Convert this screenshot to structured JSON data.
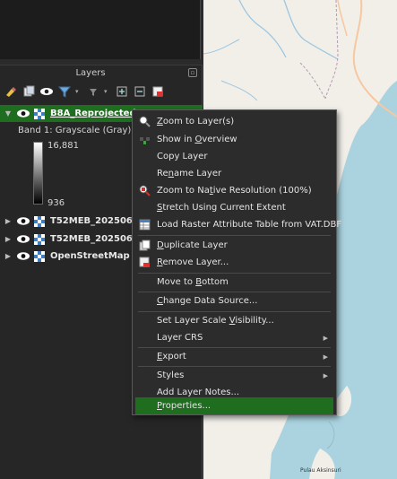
{
  "layers_panel": {
    "title": "Layers",
    "toolbar_icons": [
      "open-layer-styling-icon",
      "add-group-icon",
      "manage-visibility-icon",
      "filter-legend-icon",
      "filter-by-expression-icon",
      "expand-all-icon",
      "collapse-all-icon",
      "remove-layer-icon"
    ]
  },
  "layers": [
    {
      "name": "B8A_Reprojected",
      "selected": true,
      "expanded": true
    },
    {
      "name": "T52MEB_20250610T",
      "selected": false,
      "expanded": false
    },
    {
      "name": "T52MEB_20250610T",
      "selected": false,
      "expanded": false
    },
    {
      "name": "OpenStreetMap",
      "selected": false,
      "expanded": false
    }
  ],
  "legend": {
    "band_label": "Band 1: Grayscale (Gray)",
    "max": "16,881",
    "min": "936"
  },
  "context_menu": {
    "items": [
      {
        "pre": "",
        "mn": "Z",
        "post": "oom to Layer(s)",
        "icon": "zoom-to-layer-icon"
      },
      {
        "pre": "Show in ",
        "mn": "O",
        "post": "verview",
        "icon": "show-overview-icon"
      },
      {
        "pre": "Copy Layer",
        "mn": "",
        "post": "",
        "icon": ""
      },
      {
        "pre": "Re",
        "mn": "n",
        "post": "ame Layer",
        "icon": ""
      },
      {
        "pre": "Zoom to Na",
        "mn": "t",
        "post": "ive Resolution (100%)",
        "icon": "zoom-native-icon"
      },
      {
        "pre": "",
        "mn": "S",
        "post": "tretch Using Current Extent",
        "icon": ""
      },
      {
        "pre": "Load Raster Attribute Table from VAT.DBF",
        "mn": "",
        "post": "",
        "icon": "table-icon"
      },
      {
        "pre": "",
        "mn": "D",
        "post": "uplicate Layer",
        "icon": "duplicate-icon"
      },
      {
        "pre": "",
        "mn": "R",
        "post": "emove Layer...",
        "icon": "remove-icon"
      },
      {
        "pre": "Move to ",
        "mn": "B",
        "post": "ottom",
        "icon": ""
      },
      {
        "pre": "",
        "mn": "C",
        "post": "hange Data Source...",
        "icon": ""
      },
      {
        "pre": "Set Layer Scale ",
        "mn": "V",
        "post": "isibility...",
        "icon": ""
      },
      {
        "pre": "Layer CRS",
        "mn": "",
        "post": "",
        "icon": "",
        "submenu": true
      },
      {
        "pre": "",
        "mn": "E",
        "post": "xport",
        "icon": "",
        "submenu": true
      },
      {
        "pre": "Styles",
        "mn": "",
        "post": "",
        "icon": "",
        "submenu": true
      },
      {
        "pre": "Add Layer Notes...",
        "mn": "",
        "post": "",
        "icon": ""
      },
      {
        "pre": "",
        "mn": "P",
        "post": "roperties...",
        "icon": "",
        "highlighted": true
      }
    ]
  },
  "map": {
    "place_label": "Pulau Aksinsuri",
    "colors": {
      "land": "#f2efe9",
      "sea": "#aad3df",
      "river": "#9cc7e0",
      "road": "#f7c7a0",
      "border": "#b59ab5"
    }
  }
}
